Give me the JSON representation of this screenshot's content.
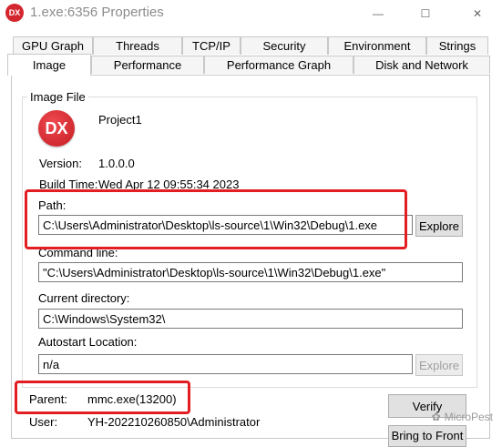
{
  "window": {
    "title": "1.exe:6356 Properties",
    "icon_text": "DX",
    "controls": {
      "minimize": "—",
      "maximize": "☐",
      "close": "✕"
    }
  },
  "tabs_row1": [
    "GPU Graph",
    "Threads",
    "TCP/IP",
    "Security",
    "Environment",
    "Strings"
  ],
  "tabs_row2": [
    "Image",
    "Performance",
    "Performance Graph",
    "Disk and Network"
  ],
  "image_file": {
    "group_title": "Image File",
    "logo_text": "DX",
    "description": "Project1",
    "version_label": "Version:",
    "version_value": "1.0.0.0",
    "build_label": "Build Time:",
    "build_value": "Wed Apr 12 09:55:34 2023"
  },
  "path": {
    "label": "Path:",
    "value": "C:\\Users\\Administrator\\Desktop\\ls-source\\1\\Win32\\Debug\\1.exe",
    "button": "Explore"
  },
  "command_line": {
    "label": "Command line:",
    "value": "\"C:\\Users\\Administrator\\Desktop\\ls-source\\1\\Win32\\Debug\\1.exe\""
  },
  "current_directory": {
    "label": "Current directory:",
    "value": "C:\\Windows\\System32\\"
  },
  "autostart": {
    "label": "Autostart Location:",
    "value": "n/a",
    "button": "Explore"
  },
  "parent": {
    "label": "Parent:",
    "value": "mmc.exe(13200)"
  },
  "user": {
    "label": "User:",
    "value": "YH-202210260850\\Administrator"
  },
  "buttons": {
    "verify": "Verify",
    "bring_to_front": "Bring to Front"
  },
  "watermark": {
    "text": "MicroPest"
  },
  "colors": {
    "highlight": "#e21e22",
    "logo": "#d4262e"
  }
}
